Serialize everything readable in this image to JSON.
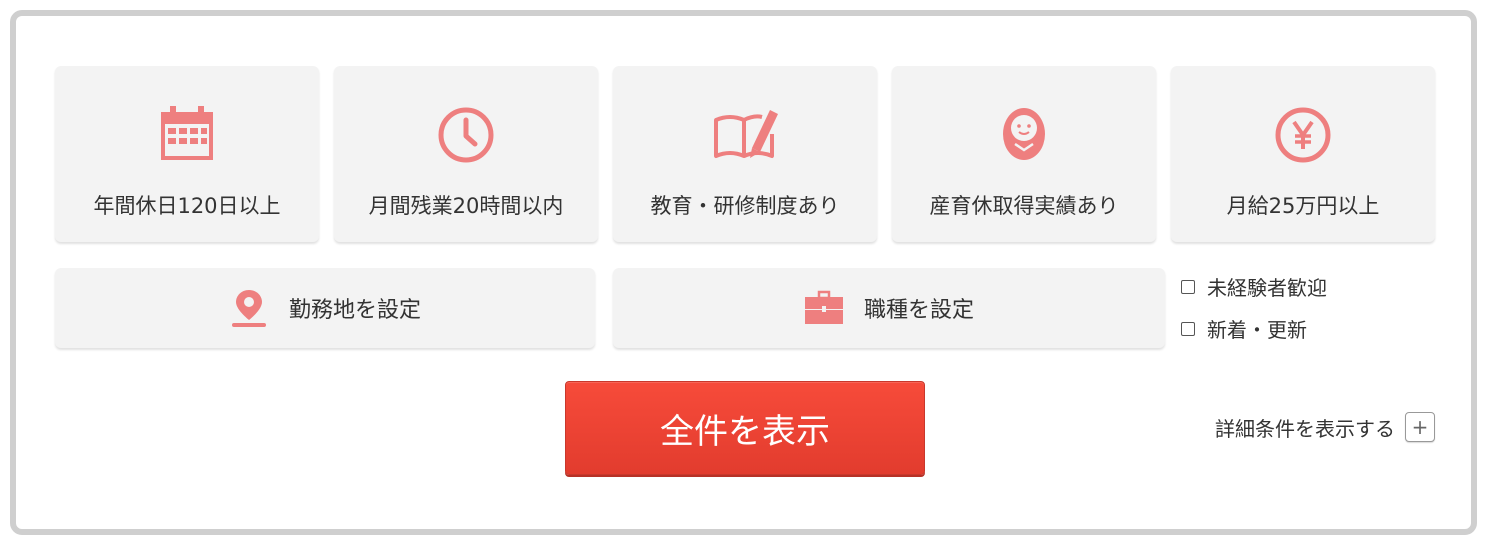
{
  "theme": {
    "icon_color": "#ee7f7f",
    "button_color": "#ef4233"
  },
  "features": [
    {
      "label": "年間休日120日以上",
      "icon": "calendar-icon"
    },
    {
      "label": "月間残業20時間以内",
      "icon": "clock-icon"
    },
    {
      "label": "教育・研修制度あり",
      "icon": "book-pencil-icon"
    },
    {
      "label": "産育休取得実績あり",
      "icon": "baby-icon"
    },
    {
      "label": "月給25万円以上",
      "icon": "yen-icon"
    }
  ],
  "location": {
    "label": "勤務地を設定",
    "icon": "map-pin-icon"
  },
  "job_type": {
    "label": "職種を設定",
    "icon": "briefcase-icon"
  },
  "checkboxes": [
    {
      "label": "未経験者歓迎",
      "checked": false
    },
    {
      "label": "新着・更新",
      "checked": false
    }
  ],
  "show_all_label": "全件を表示",
  "detail": {
    "label": "詳細条件を表示する",
    "toggle_symbol": "+"
  }
}
